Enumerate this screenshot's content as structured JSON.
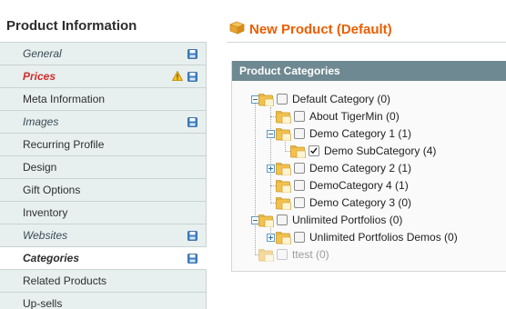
{
  "sidebar": {
    "title": "Product Information",
    "items": [
      {
        "label": "General",
        "style": "italic",
        "save_icon": true
      },
      {
        "label": "Prices",
        "style": "error",
        "save_icon": true,
        "warning_icon": true
      },
      {
        "label": "Meta Information",
        "style": "normal"
      },
      {
        "label": "Images",
        "style": "italic",
        "save_icon": true
      },
      {
        "label": "Recurring Profile",
        "style": "normal"
      },
      {
        "label": "Design",
        "style": "normal"
      },
      {
        "label": "Gift Options",
        "style": "normal"
      },
      {
        "label": "Inventory",
        "style": "normal"
      },
      {
        "label": "Websites",
        "style": "italic",
        "save_icon": true
      },
      {
        "label": "Categories",
        "style": "active",
        "save_icon": true
      },
      {
        "label": "Related Products",
        "style": "normal"
      },
      {
        "label": "Up-sells",
        "style": "normal"
      }
    ]
  },
  "main": {
    "page_title": "New Product (Default)",
    "panel_title": "Product Categories"
  },
  "tree": [
    {
      "label": "Default Category (0)",
      "level": 0,
      "expander": "minus",
      "checked": false
    },
    {
      "label": "About TigerMin (0)",
      "level": 1,
      "expander": "none",
      "checked": false
    },
    {
      "label": "Demo Category 1 (1)",
      "level": 1,
      "expander": "minus",
      "checked": false
    },
    {
      "label": "Demo SubCategory (4)",
      "level": 2,
      "expander": "none",
      "checked": true
    },
    {
      "label": "Demo Category 2 (1)",
      "level": 1,
      "expander": "plus",
      "checked": false
    },
    {
      "label": "DemoCategory 4 (1)",
      "level": 1,
      "expander": "none",
      "checked": false
    },
    {
      "label": "Demo Category 3 (0)",
      "level": 1,
      "expander": "none",
      "checked": false
    },
    {
      "label": "Unlimited Portfolios (0)",
      "level": 0,
      "expander": "minus",
      "checked": false
    },
    {
      "label": "Unlimited Portfolios Demos (0)",
      "level": 1,
      "expander": "plus",
      "checked": false
    },
    {
      "label": "ttest (0)",
      "level": 0,
      "expander": "none",
      "checked": false,
      "disabled": true
    }
  ],
  "colors": {
    "accent": "#eb5e00",
    "error": "#d42c2c",
    "panel_header": "#6f8992",
    "sidebar_bg": "#e7efef",
    "save_icon": "#3b7fc4",
    "folder": "#f2c14e"
  },
  "icons": {
    "save": "floppy-disk-icon",
    "warning": "warning-icon",
    "header": "product-box-icon",
    "folder": "folder-icon",
    "expand": "plus-icon",
    "collapse": "minus-icon"
  }
}
